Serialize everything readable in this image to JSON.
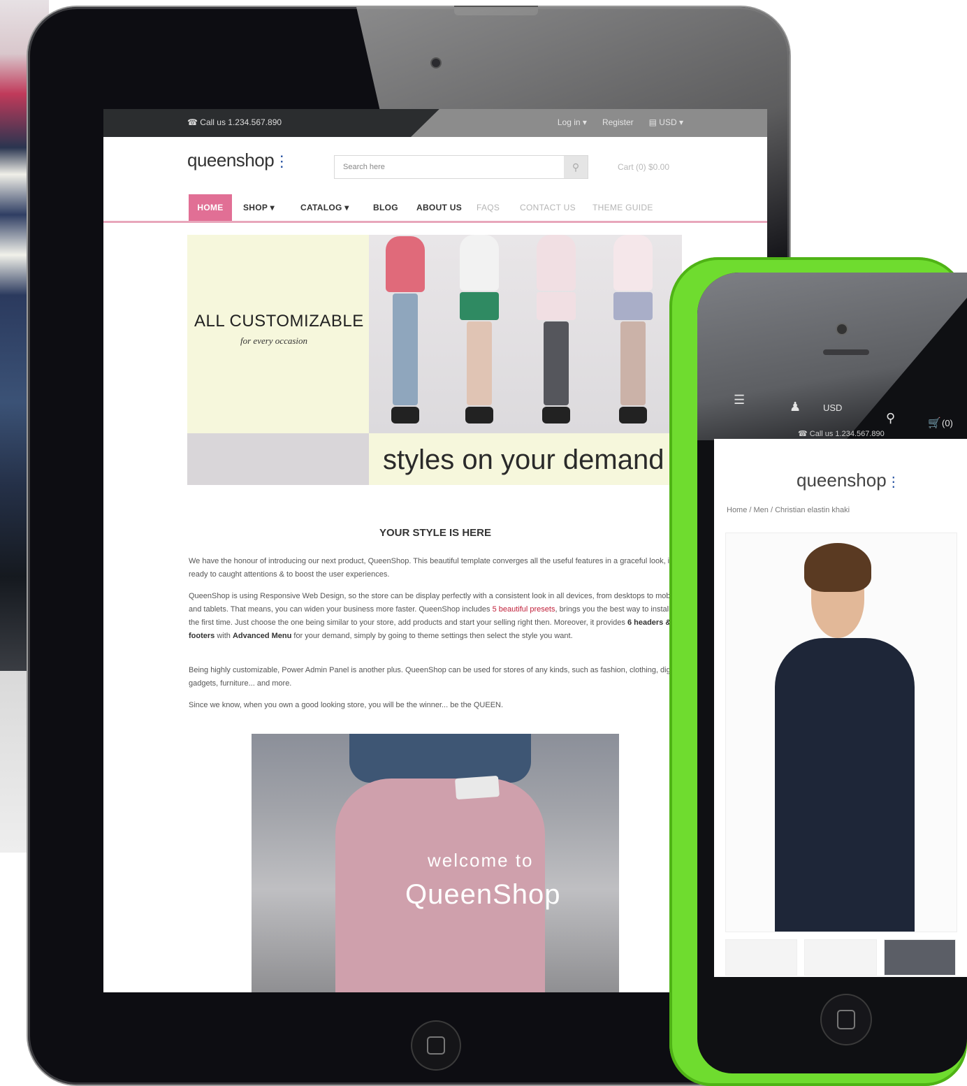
{
  "tablet": {
    "topbar": {
      "call": "☎ Call us 1.234.567.890",
      "login": "Log in ▾",
      "register": "Register",
      "currency": "▤ USD ▾"
    },
    "header": {
      "logo": "queenshop",
      "search_placeholder": "Search here",
      "cart": "Cart (0) $0.00"
    },
    "nav": {
      "items": [
        "HOME",
        "SHOP ▾",
        "CATALOG ▾",
        "BLOG",
        "ABOUT US",
        "FAQS",
        "CONTACT US",
        "THEME GUIDE"
      ]
    },
    "banner": {
      "title": "ALL CUSTOMIZABLE",
      "subtitle": "for every occasion",
      "tagline": "styles on your demand"
    },
    "content": {
      "heading": "YOUR STYLE IS HERE",
      "p1": "We have the honour of introducing our next product, QueenShop. This beautiful template converges all the useful features in a graceful look, is ready to caught attentions & to boost the user experiences.",
      "p2_a": "QueenShop is using Responsive Web Design, so the store can be display perfectly with a consistent look in all devices, from desktops to mobiles and tablets. That means, you can widen your business more faster. QueenShop includes ",
      "p2_link": "5 beautiful presets",
      "p2_b": ", brings you the best way to install for the first time. Just choose the one being similar to your store, add products and start your selling right then. Moreover, it provides ",
      "p2_bold1": "6 headers & 2 footers",
      "p2_c": " with ",
      "p2_bold2": "Advanced Menu",
      "p2_d": " for your demand, simply by going to theme settings then select the style you want.",
      "p3": "Being highly customizable, Power Admin Panel is another plus. QueenShop can be used for stores of any kinds, such as fashion, clothing, digital gadgets, furniture... and more.",
      "p4": "Since we know, when you own a good looking store, you will be the winner... be the QUEEN."
    },
    "promo": {
      "line1": "welcome to",
      "line2": "QueenShop"
    }
  },
  "phone": {
    "currency": "USD",
    "cart": "(0)",
    "call": "☎ Call us 1.234.567.890",
    "logo": "queenshop",
    "breadcrumb": "Home / Men / Christian elastin khaki"
  },
  "colors": {
    "accent_pink": "#e16f95",
    "phone_green": "#6fdc2f",
    "link_red": "#c0203a"
  }
}
